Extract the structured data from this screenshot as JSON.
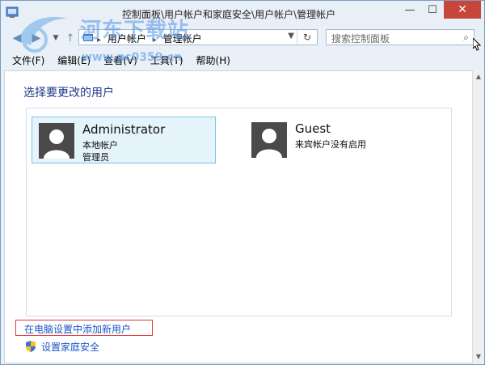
{
  "window": {
    "title": "控制面板\\用户帐户和家庭安全\\用户帐户\\管理帐户",
    "minimize": "—",
    "maximize": "☐",
    "close": "✕"
  },
  "address": {
    "crumbs": [
      "用户帐户",
      "管理帐户"
    ],
    "search_placeholder": "搜索控制面板"
  },
  "menu": [
    "文件(F)",
    "编辑(E)",
    "查看(V)",
    "工具(T)",
    "帮助(H)"
  ],
  "content": {
    "heading": "选择要更改的用户",
    "users": [
      {
        "name": "Administrator",
        "lines": [
          "本地帐户",
          "管理员"
        ],
        "selected": true
      },
      {
        "name": "Guest",
        "lines": [
          "来宾帐户没有启用"
        ],
        "selected": false
      }
    ],
    "add_user_link": "在电脑设置中添加新用户",
    "family_safety_link": "设置家庭安全"
  },
  "watermark": {
    "text": "河东下载站",
    "url": "www.pc0359.cn"
  },
  "colors": {
    "link": "#1a56c4",
    "heading": "#1e3a8a",
    "close": "#c7463b",
    "highlight": "#e03a3a"
  }
}
